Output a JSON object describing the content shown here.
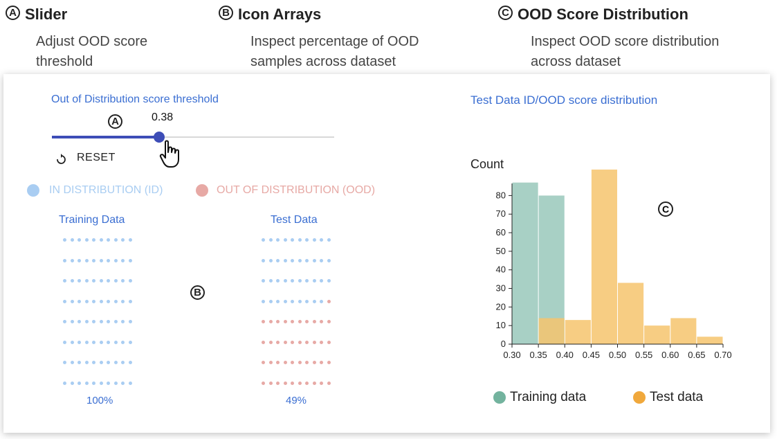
{
  "headers": [
    {
      "badge": "A",
      "title": "Slider",
      "desc_lines": [
        "Adjust OOD score",
        "threshold"
      ]
    },
    {
      "badge": "B",
      "title": "Icon Arrays",
      "desc_lines": [
        "Inspect percentage of OOD",
        "samples across dataset"
      ]
    },
    {
      "badge": "C",
      "title": "OOD Score Distribution",
      "desc_lines": [
        "Inspect OOD score distribution",
        "across dataset"
      ]
    }
  ],
  "slider": {
    "title": "Out of Distribution score threshold",
    "value_text": "0.38",
    "value": 0.38,
    "badge": "A",
    "reset_label": "RESET"
  },
  "legend_icons": {
    "id_label": "IN DISTRIBUTION (ID)",
    "ood_label": "OUT OF DISTRIBUTION (OOD)"
  },
  "icon_arrays": {
    "badge": "B",
    "training": {
      "title": "Training Data",
      "percent": "100%",
      "ood_count": 0
    },
    "test": {
      "title": "Test Data",
      "percent": "49%",
      "ood_count": 41
    }
  },
  "colors": {
    "id": "#a9cdf2",
    "ood": "#e7a9a5",
    "accent": "#3a6ed2",
    "slider": "#3d4db7",
    "training": "#9fcbbf",
    "test": "#f6c46d",
    "training_legend": "#73b39e",
    "test_legend": "#f0a83c"
  },
  "histogram": {
    "title": "Test Data ID/OOD score distribution",
    "badge": "C",
    "legend": {
      "training": "Training data",
      "test": "Test data"
    }
  },
  "chart_data": {
    "type": "bar",
    "ylabel": "Count",
    "xlim": [
      0.3,
      0.7
    ],
    "ylim": [
      0,
      85
    ],
    "xticks": [
      "0.30",
      "0.35",
      "0.40",
      "0.45",
      "0.50",
      "0.55",
      "0.60",
      "0.65",
      "0.70"
    ],
    "yticks": [
      "0",
      "10",
      "20",
      "30",
      "40",
      "50",
      "60",
      "70",
      "80"
    ],
    "bin_edges": [
      0.3,
      0.35,
      0.4,
      0.45,
      0.5,
      0.55,
      0.6,
      0.65,
      0.7
    ],
    "series": [
      {
        "name": "Training data",
        "values": [
          87,
          80,
          0,
          0,
          0,
          0,
          0,
          0
        ]
      },
      {
        "name": "Test data",
        "values": [
          0,
          14,
          13,
          94,
          33,
          10,
          14,
          4
        ]
      }
    ]
  }
}
